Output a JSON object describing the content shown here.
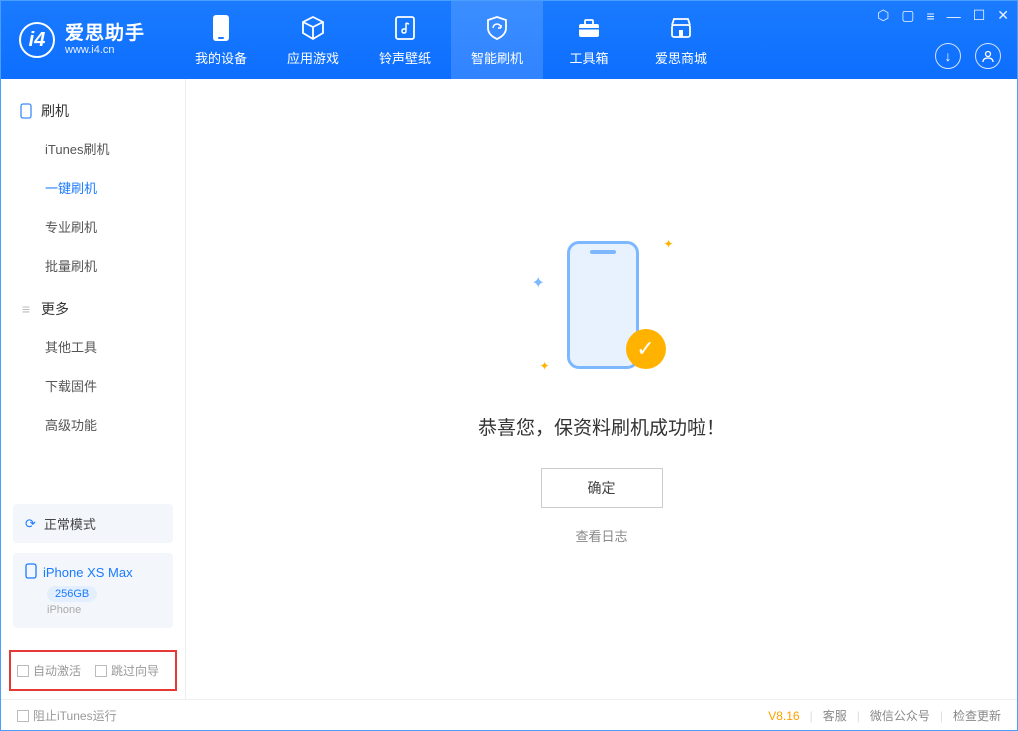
{
  "logo": {
    "title": "爱思助手",
    "subtitle": "www.i4.cn"
  },
  "nav": [
    {
      "label": "我的设备"
    },
    {
      "label": "应用游戏"
    },
    {
      "label": "铃声壁纸"
    },
    {
      "label": "智能刷机"
    },
    {
      "label": "工具箱"
    },
    {
      "label": "爱思商城"
    }
  ],
  "sidebar": {
    "section1": {
      "header": "刷机",
      "items": [
        "iTunes刷机",
        "一键刷机",
        "专业刷机",
        "批量刷机"
      ]
    },
    "section2": {
      "header": "更多",
      "items": [
        "其他工具",
        "下载固件",
        "高级功能"
      ]
    }
  },
  "device": {
    "mode": "正常模式",
    "name": "iPhone XS Max",
    "capacity": "256GB",
    "type": "iPhone"
  },
  "options": {
    "auto_activate": "自动激活",
    "skip_guide": "跳过向导"
  },
  "main": {
    "message": "恭喜您，保资料刷机成功啦！",
    "ok": "确定",
    "view_log": "查看日志"
  },
  "footer": {
    "block_itunes": "阻止iTunes运行",
    "version": "V8.16",
    "support": "客服",
    "wechat": "微信公众号",
    "update": "检查更新"
  }
}
